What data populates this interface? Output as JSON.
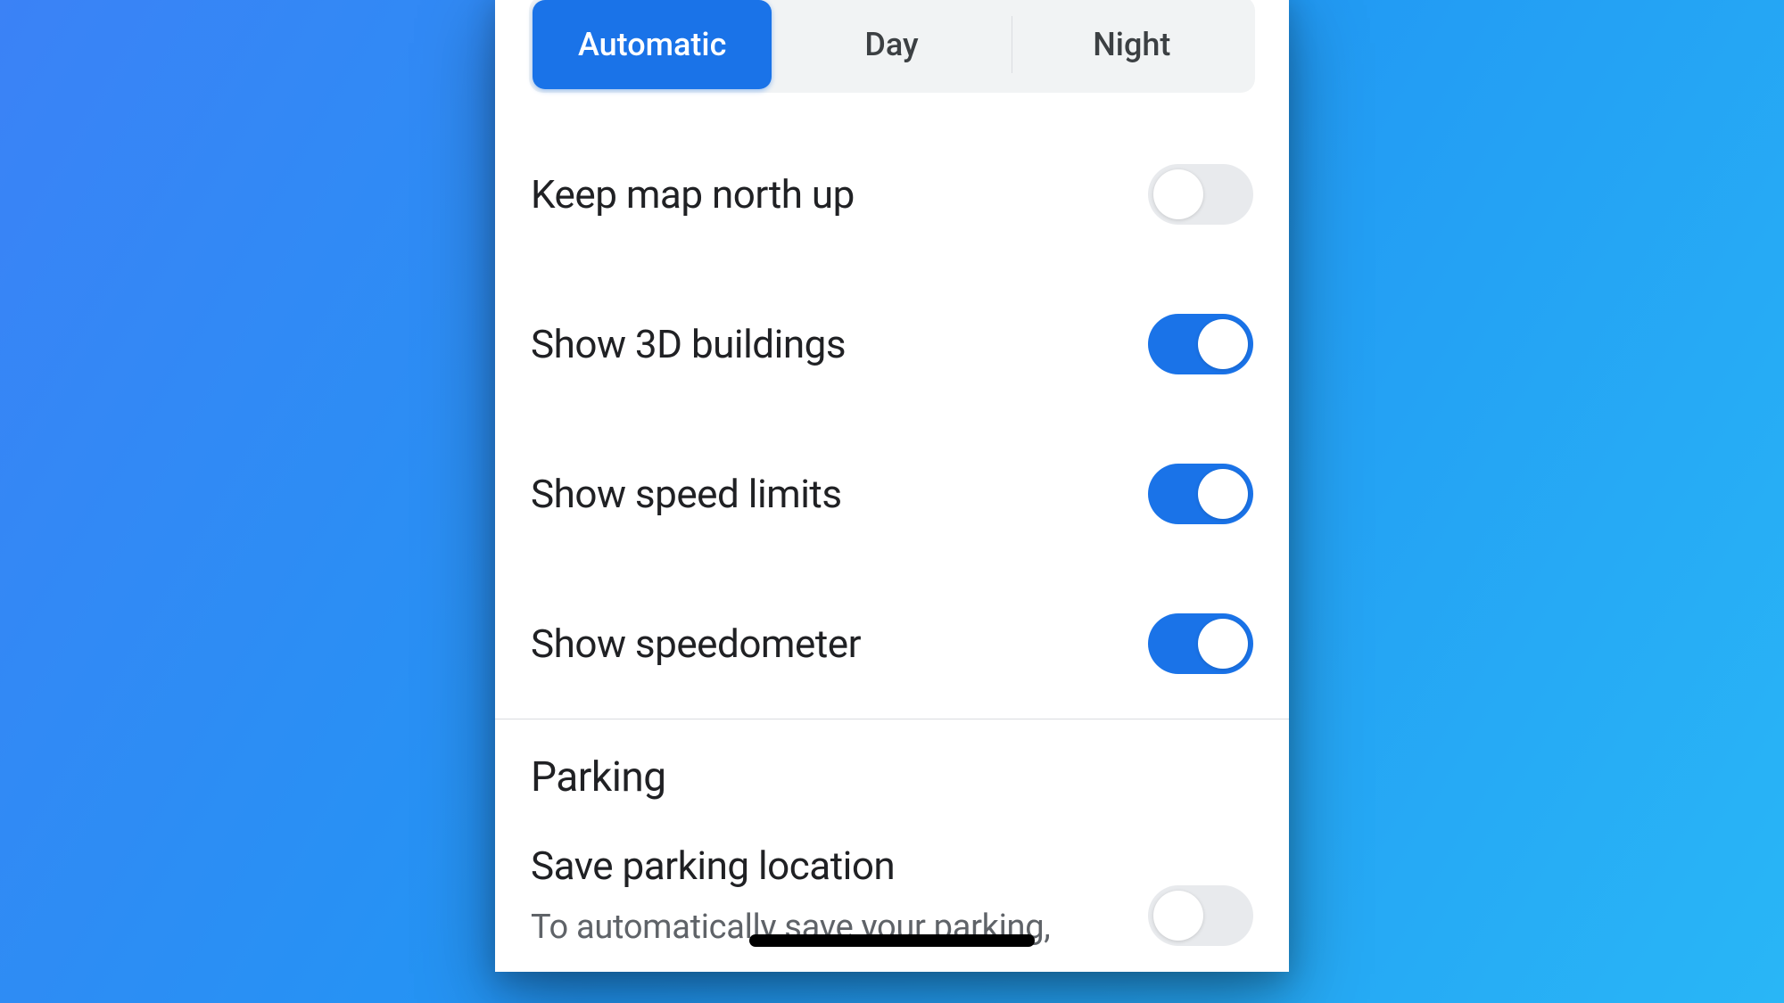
{
  "segmented": {
    "options": [
      "Automatic",
      "Day",
      "Night"
    ],
    "selected": 0
  },
  "settings": [
    {
      "label": "Keep map north up",
      "enabled": false
    },
    {
      "label": "Show 3D buildings",
      "enabled": true
    },
    {
      "label": "Show speed limits",
      "enabled": true
    },
    {
      "label": "Show speedometer",
      "enabled": true
    }
  ],
  "section": {
    "title": "Parking",
    "setting": {
      "label": "Save parking location",
      "description": "To automatically save your parking,",
      "enabled": false
    }
  }
}
